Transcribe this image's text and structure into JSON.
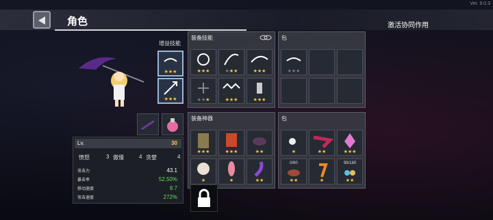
{
  "version": "Ver. 9.0.3",
  "header": {
    "title": "角色",
    "synergy_label": "激活协同作用"
  },
  "character": {
    "gain_skills_label": "增益技能"
  },
  "panels": {
    "equip_skills": "装备技能",
    "bag_top": "包",
    "equip_artifacts": "装备神器",
    "bag_bottom": "包"
  },
  "stats": {
    "level_label": "Lv.",
    "level_value": "30",
    "row1": {
      "a_label": "愤怒",
      "a_value": "3",
      "b_label": "傲慢",
      "b_value": "4",
      "c_label": "贪婪",
      "c_value": "4"
    },
    "items": [
      {
        "label": "攻击力",
        "value": "43.1",
        "color": "white"
      },
      {
        "label": "暴击率",
        "value": "52.50%",
        "color": "green"
      },
      {
        "label": "移动速度",
        "value": "8.7",
        "color": "green"
      },
      {
        "label": "攻击速度",
        "value": "272%",
        "color": "green"
      }
    ]
  },
  "bag_counts": {
    "a": "0/60",
    "b": "99/180"
  },
  "colors": {
    "gold_star": "#ffc83d",
    "grey_star": "#7a7d85",
    "accent": "#9bb8d8"
  }
}
